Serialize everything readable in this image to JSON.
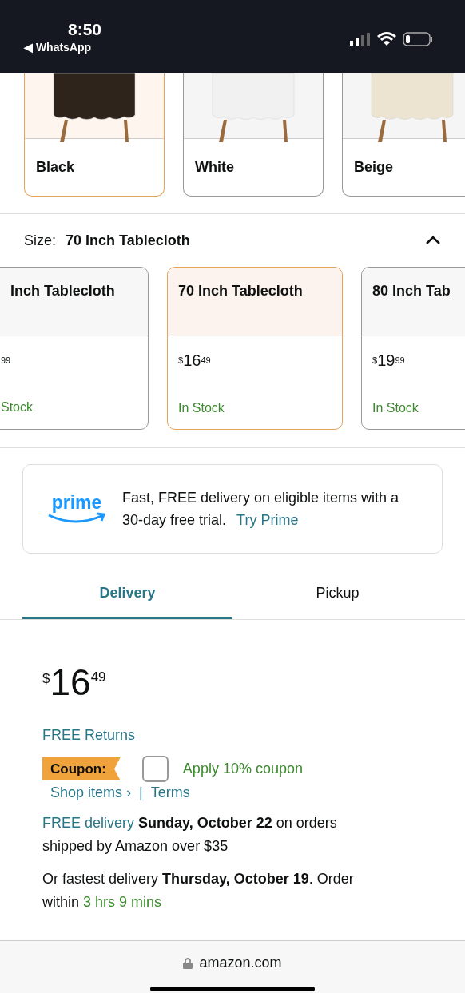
{
  "status_bar": {
    "time": "8:50",
    "back_app": "◀ WhatsApp"
  },
  "colors": [
    {
      "label": "Black",
      "selected": true,
      "color": "#2e241c"
    },
    {
      "label": "White",
      "selected": false,
      "color": "#f1f1f1"
    },
    {
      "label": "Beige",
      "selected": false,
      "color": "#ece3d0"
    }
  ],
  "size": {
    "label": "Size:",
    "value": "70 Inch Tablecloth",
    "expanded": true
  },
  "sizes": [
    {
      "title": "Inch Tablecloth",
      "cut_left": true,
      "price": {
        "fraction": "99"
      },
      "stock": "Stock",
      "selected": false
    },
    {
      "title": "70 Inch Tablecloth",
      "cut_left": false,
      "price": {
        "symbol": "$",
        "whole": "16",
        "fraction": "49"
      },
      "stock": "In Stock",
      "selected": true
    },
    {
      "title": "80 Inch Tab",
      "cut_left": false,
      "price": {
        "symbol": "$",
        "whole": "19",
        "fraction": "99"
      },
      "stock": "In Stock",
      "selected": false
    }
  ],
  "prime": {
    "logo": "prime",
    "text": "Fast, FREE delivery on eligible items with a 30-day free trial.",
    "link": "Try Prime"
  },
  "tabs": [
    {
      "label": "Delivery",
      "selected": true
    },
    {
      "label": "Pickup",
      "selected": false
    }
  ],
  "price": {
    "symbol": "$",
    "whole": "16",
    "fraction": "49"
  },
  "returns": "FREE Returns",
  "coupon": {
    "badge": "Coupon:",
    "checked": false,
    "label": "Apply 10% coupon",
    "shop": "Shop items ›",
    "separator": "|",
    "terms": "Terms"
  },
  "delivery_lines": [
    {
      "link": "FREE delivery",
      "text": "**Sunday, October 22** on orders shipped by Amazon over $35"
    },
    {
      "text": "Or fastest delivery **Thursday, October 19**. Order within",
      "countdown": "3 hrs 9 mins"
    }
  ],
  "browser": {
    "url": "amazon.com"
  }
}
